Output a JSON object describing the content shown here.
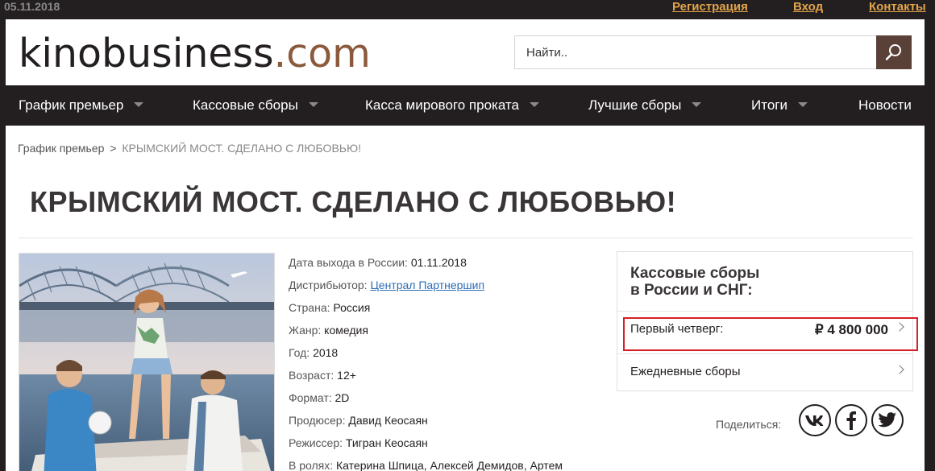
{
  "topbar": {
    "date": "05.11.2018",
    "links": [
      "Регистрация",
      "Вход",
      "Контакты"
    ]
  },
  "header": {
    "logo_main": "kinobusiness",
    "logo_domain": ".com",
    "search_placeholder": "Найти.."
  },
  "nav": {
    "items": [
      {
        "label": "График премьер",
        "has_dropdown": true
      },
      {
        "label": "Кассовые сборы",
        "has_dropdown": true
      },
      {
        "label": "Касса мирового проката",
        "has_dropdown": true
      },
      {
        "label": "Лучшие сборы",
        "has_dropdown": true
      },
      {
        "label": "Итоги",
        "has_dropdown": true
      },
      {
        "label": "Новости",
        "has_dropdown": false
      }
    ]
  },
  "breadcrumb": {
    "parent": "График премьер",
    "separator": ">",
    "current": "КРЫМСКИЙ МОСТ. СДЕЛАНО С ЛЮБОВЬЮ!"
  },
  "film": {
    "title": "КРЫМСКИЙ МОСТ. СДЕЛАНО С ЛЮБОВЬЮ!",
    "info": [
      {
        "label": "Дата выхода в России:",
        "value": "01.11.2018",
        "link": false
      },
      {
        "label": "Дистрибьютор:",
        "value": "Централ Партнершип",
        "link": true
      },
      {
        "label": "Страна:",
        "value": "Россия",
        "link": false
      },
      {
        "label": "Жанр:",
        "value": "комедия",
        "link": false
      },
      {
        "label": "Год:",
        "value": "2018",
        "link": false
      },
      {
        "label": "Возраст:",
        "value": "12+",
        "link": false
      },
      {
        "label": "Формат:",
        "value": "2D",
        "link": false
      },
      {
        "label": "Продюсер:",
        "value": "Давид Кеосаян",
        "link": false
      },
      {
        "label": "Режиссер:",
        "value": "Тигран Кеосаян",
        "link": false
      },
      {
        "label": "В ролях:",
        "value": "Катерина Шпица, Алексей Демидов, Артем",
        "link": false
      }
    ]
  },
  "boxoffice": {
    "title_line1": "Кассовые сборы",
    "title_line2": "в России и СНГ:",
    "first_thursday_label": "Первый четверг:",
    "first_thursday_value": "₽ 4 800 000",
    "daily_label": "Ежедневные сборы"
  },
  "share": {
    "label": "Поделиться:",
    "networks": [
      "vk-icon",
      "facebook-icon",
      "twitter-icon"
    ]
  },
  "colors": {
    "dark": "#231f20",
    "accent": "#e2a44c",
    "brown": "#8b5a3c",
    "link": "#2d6db5",
    "highlight": "#d61f26"
  }
}
